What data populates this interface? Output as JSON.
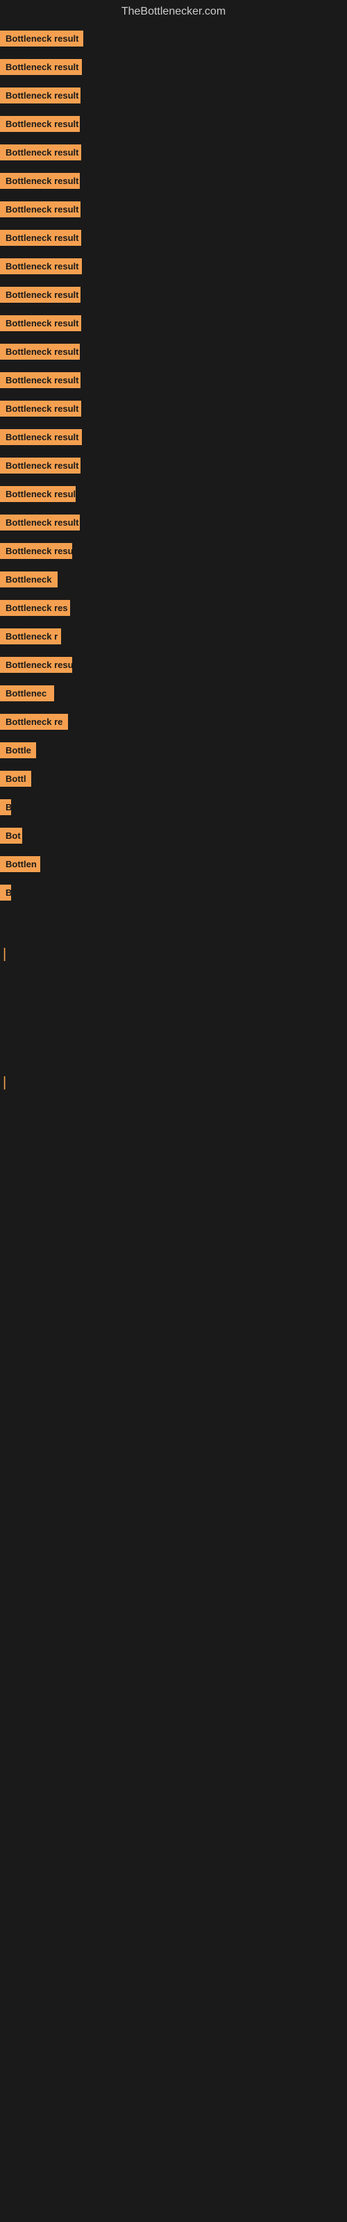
{
  "site": {
    "title": "TheBottlenecker.com"
  },
  "bars": [
    {
      "label": "Bottleneck result",
      "width": 120
    },
    {
      "label": "Bottleneck result",
      "width": 118
    },
    {
      "label": "Bottleneck result",
      "width": 116
    },
    {
      "label": "Bottleneck result",
      "width": 115
    },
    {
      "label": "Bottleneck result",
      "width": 117
    },
    {
      "label": "Bottleneck result",
      "width": 115
    },
    {
      "label": "Bottleneck result",
      "width": 116
    },
    {
      "label": "Bottleneck result",
      "width": 117
    },
    {
      "label": "Bottleneck result",
      "width": 118
    },
    {
      "label": "Bottleneck result",
      "width": 116
    },
    {
      "label": "Bottleneck result",
      "width": 117
    },
    {
      "label": "Bottleneck result",
      "width": 115
    },
    {
      "label": "Bottleneck result",
      "width": 116
    },
    {
      "label": "Bottleneck result",
      "width": 117
    },
    {
      "label": "Bottleneck result",
      "width": 118
    },
    {
      "label": "Bottleneck result",
      "width": 116
    },
    {
      "label": "Bottleneck result",
      "width": 109
    },
    {
      "label": "Bottleneck result",
      "width": 115
    },
    {
      "label": "Bottleneck resu",
      "width": 104
    },
    {
      "label": "Bottleneck",
      "width": 83
    },
    {
      "label": "Bottleneck res",
      "width": 101
    },
    {
      "label": "Bottleneck r",
      "width": 88
    },
    {
      "label": "Bottleneck resu",
      "width": 104
    },
    {
      "label": "Bottlenec",
      "width": 78
    },
    {
      "label": "Bottleneck re",
      "width": 98
    },
    {
      "label": "Bottle",
      "width": 52
    },
    {
      "label": "Bottl",
      "width": 45
    },
    {
      "label": "B",
      "width": 14
    },
    {
      "label": "Bot",
      "width": 32
    },
    {
      "label": "Bottlen",
      "width": 58
    },
    {
      "label": "B",
      "width": 14
    },
    {
      "label": "",
      "width": 0
    },
    {
      "label": "|",
      "width": 8
    },
    {
      "label": "",
      "width": 0
    },
    {
      "label": "",
      "width": 0
    },
    {
      "label": "",
      "width": 0
    },
    {
      "label": "|",
      "width": 8
    }
  ]
}
